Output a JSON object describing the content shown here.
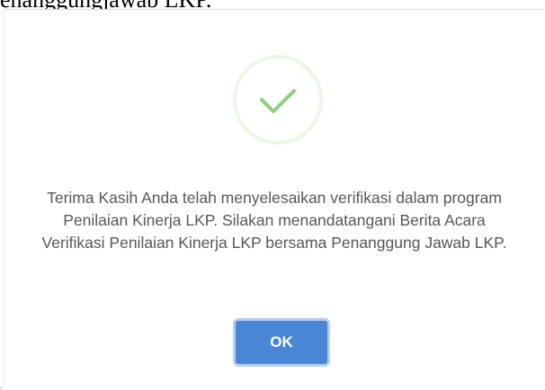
{
  "page": {
    "heading_fragment": "enanggungjawab LKP."
  },
  "dialog": {
    "icon": "success-checkmark-icon",
    "message": "Terima Kasih Anda telah menyelesaikan verifikasi dalam program Penilaian Kinerja LKP. Silakan menandatangani Berita Acara Verifikasi Penilaian Kinerja LKP bersama Penanggung Jawab LKP.",
    "ok_label": "OK"
  },
  "colors": {
    "check": "#8cd07a",
    "button": "#4a86d6",
    "button_ring": "#b7cde9",
    "text": "#575757"
  }
}
